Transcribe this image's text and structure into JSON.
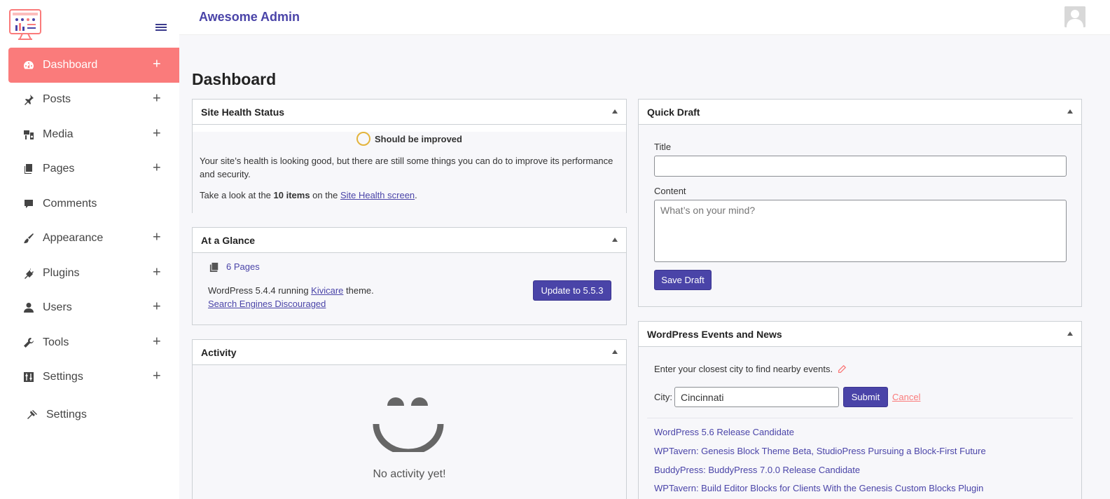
{
  "app": {
    "brand": "Awesome Admin",
    "page_title": "Dashboard"
  },
  "sidebar": {
    "items": [
      {
        "label": "Dashboard",
        "icon": "dashboard-icon",
        "active": true
      },
      {
        "label": "Posts",
        "icon": "pin-icon"
      },
      {
        "label": "Media",
        "icon": "media-icon"
      },
      {
        "label": "Pages",
        "icon": "pages-icon"
      },
      {
        "label": "Comments",
        "icon": "comment-icon"
      },
      {
        "label": "Appearance",
        "icon": "brush-icon"
      },
      {
        "label": "Plugins",
        "icon": "plugin-icon"
      },
      {
        "label": "Users",
        "icon": "user-icon"
      },
      {
        "label": "Tools",
        "icon": "wrench-icon"
      },
      {
        "label": "Settings",
        "icon": "settings-icon"
      },
      {
        "label": "Settings",
        "icon": "hammer-icon"
      }
    ],
    "plus": "+"
  },
  "site_health": {
    "title": "Site Health Status",
    "status": "Should be improved",
    "text": "Your site’s health is looking good, but there are still some things you can do to improve its performance and security.",
    "take_look_prefix": "Take a look at the ",
    "items_count": "10 items",
    "on_the": " on the ",
    "screen_link": "Site Health screen",
    "period": "."
  },
  "glance": {
    "title": "At a Glance",
    "pages": "6 Pages",
    "wp_prefix": "WordPress 5.4.4 running ",
    "theme_link": "Kivicare",
    "wp_suffix": " theme.",
    "search_engines": "Search Engines Discouraged",
    "update_button": "Update to 5.5.3"
  },
  "activity": {
    "title": "Activity",
    "empty": "No activity yet!"
  },
  "quick_draft": {
    "title": "Quick Draft",
    "title_label": "Title",
    "title_value": "",
    "content_label": "Content",
    "content_placeholder": "What’s on your mind?",
    "save_button": "Save Draft"
  },
  "events": {
    "title": "WordPress Events and News",
    "prompt": "Enter your closest city to find nearby events.",
    "city_label": "City:",
    "city_value": "Cincinnati",
    "submit": "Submit",
    "cancel": "Cancel",
    "news": [
      "WordPress 5.6 Release Candidate",
      "WPTavern: Genesis Block Theme Beta, StudioPress Pursuing a Block-First Future",
      "BuddyPress: BuddyPress 7.0.0 Release Candidate",
      "WPTavern: Build Editor Blocks for Clients With the Genesis Custom Blocks Plugin"
    ]
  },
  "colors": {
    "accent": "#4a44a8",
    "active_menu": "#fa7b7b",
    "health_ring": "#e3b43c",
    "cancel_link": "#fa7b7b"
  }
}
